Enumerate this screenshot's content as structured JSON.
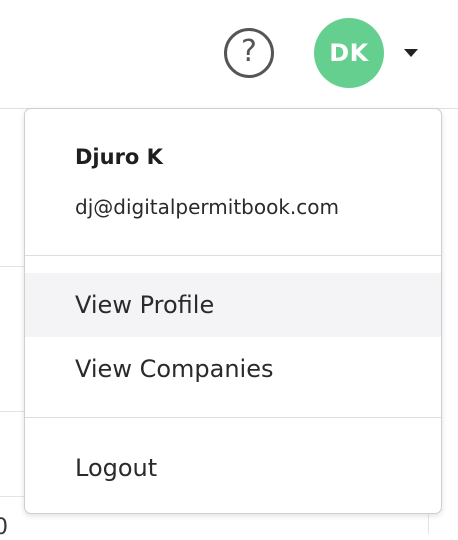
{
  "header": {
    "help_icon": "question-circle-icon",
    "help_glyph": "?",
    "avatar_initials": "DK",
    "avatar_color": "#65cf8f",
    "dropdown_caret_icon": "caret-down-icon"
  },
  "dropdown": {
    "user_name": "Djuro K",
    "user_email": "dj@digitalpermitbook.com",
    "items": [
      {
        "label": "View Profile",
        "highlighted": true
      },
      {
        "label": "View Companies",
        "highlighted": false
      },
      {
        "label": "Logout",
        "highlighted": false
      }
    ]
  },
  "background": {
    "edge_text": "0"
  }
}
